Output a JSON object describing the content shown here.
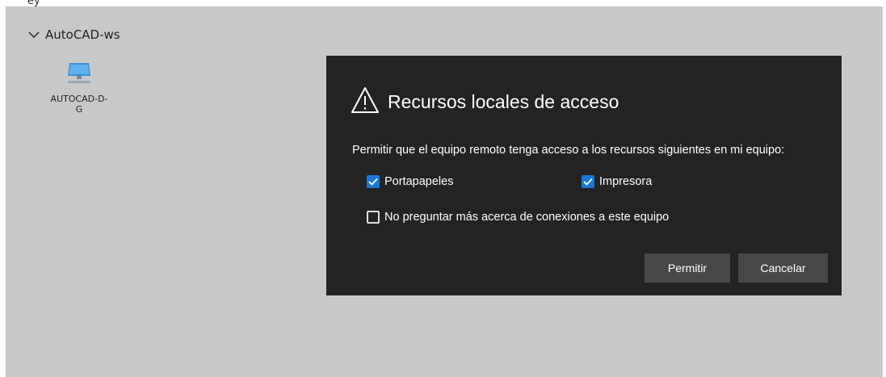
{
  "top_fragment": "ey",
  "group": {
    "label": "AutoCAD-ws",
    "expand_icon": "chevron-down-icon"
  },
  "desktop_tile": {
    "label": "AUTOCAD-D- G",
    "icon": "monitor-icon"
  },
  "dialog": {
    "icon": "warning-triangle-icon",
    "title": "Recursos locales de acceso",
    "message": "Permitir que el equipo remoto tenga acceso a los recursos siguientes en mi equipo:",
    "options": [
      {
        "label": "Portapapeles",
        "checked": true
      },
      {
        "label": "Impresora",
        "checked": true
      },
      {
        "label": "No preguntar más acerca de conexiones a este equipo",
        "checked": false
      }
    ],
    "buttons": {
      "allow": "Permitir",
      "cancel": "Cancelar"
    }
  },
  "colors": {
    "workspace_bg": "#c8c8c8",
    "dialog_bg": "#232323",
    "accent": "#1a78d4",
    "button_bg": "#474747"
  }
}
